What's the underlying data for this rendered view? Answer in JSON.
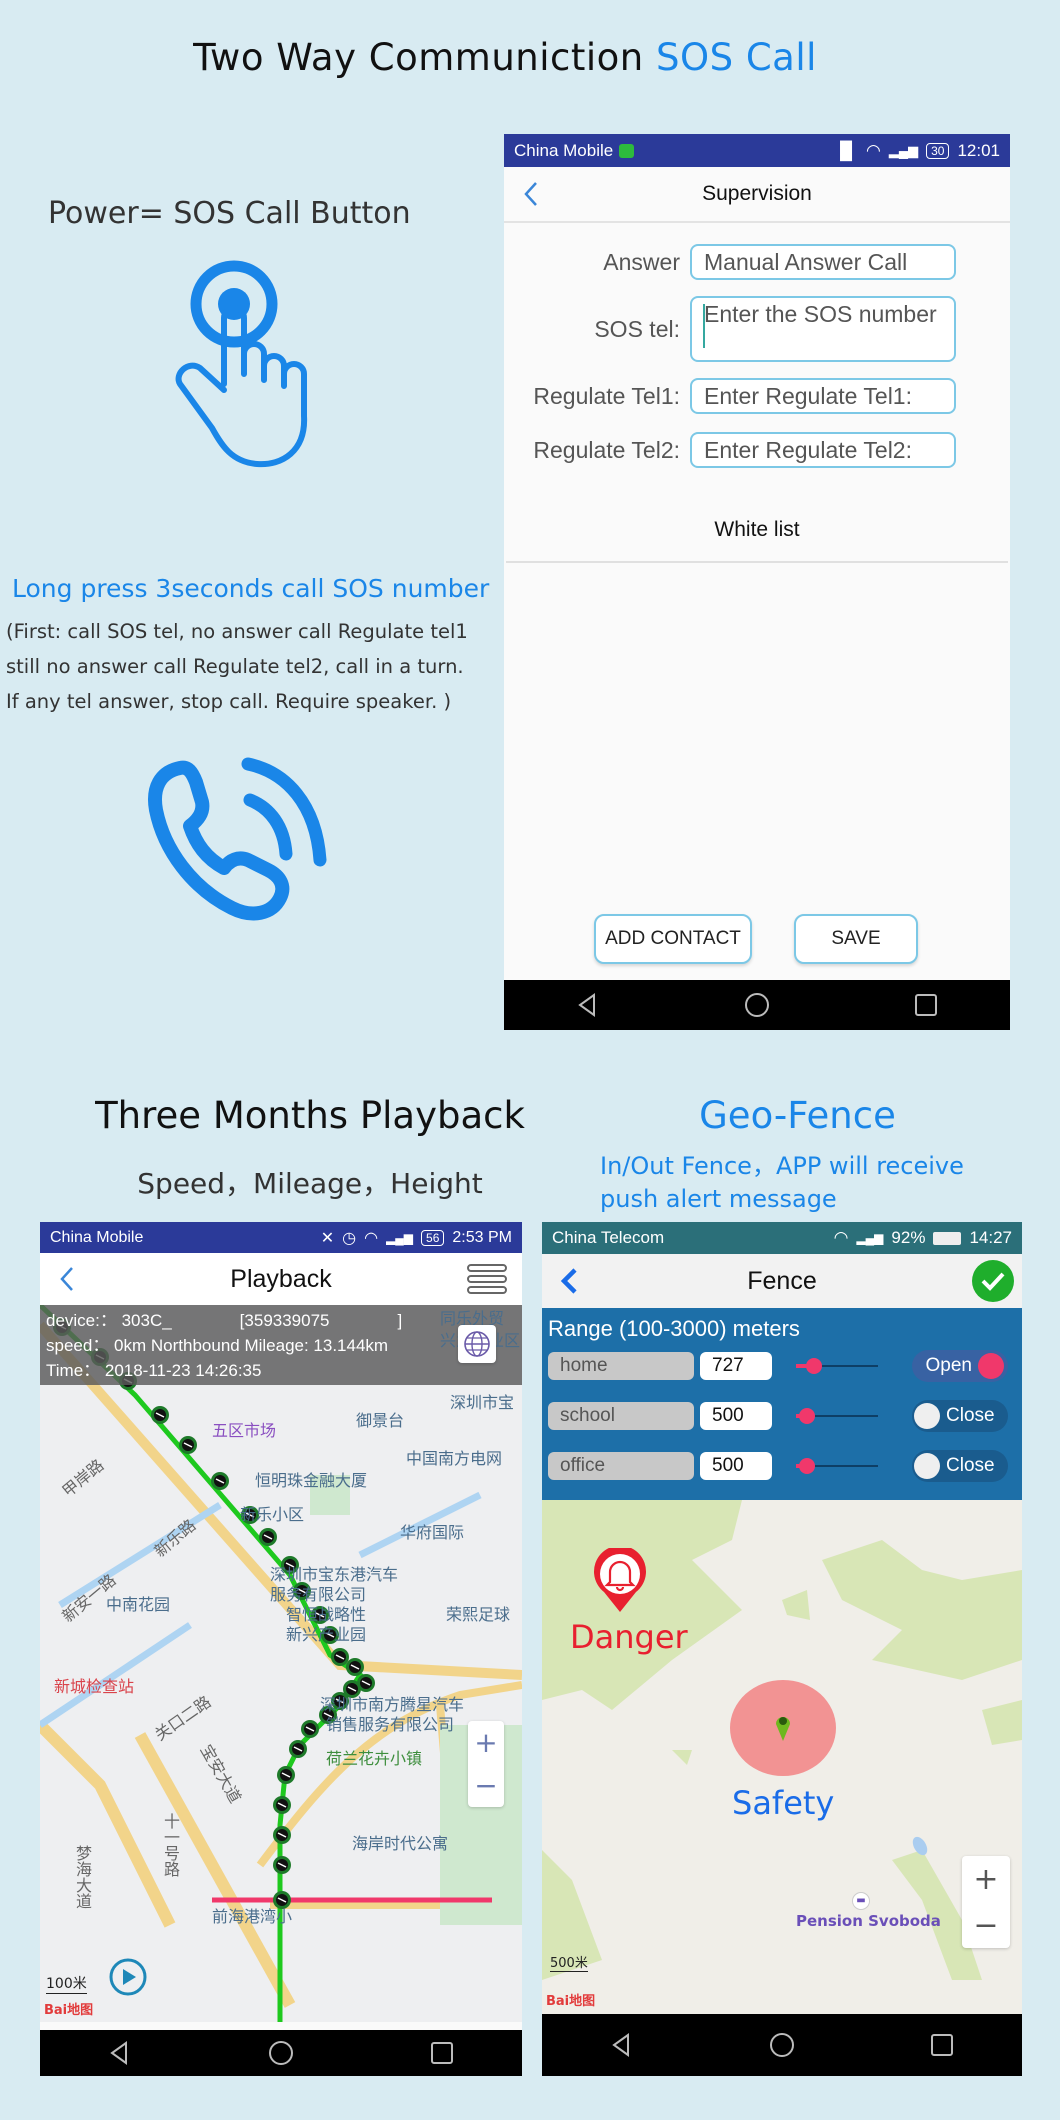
{
  "page": {
    "main_title": "Two Way Communiction ",
    "main_title_accent": "SOS Call",
    "power_label": "Power= SOS Call Button",
    "long_press": "Long press 3seconds call SOS number",
    "note_lines": [
      "(First: call SOS tel, no answer call Regulate tel1",
      "still no answer call Regulate tel2, call in a turn.",
      "If any tel answer, stop call. Require speaker. )"
    ],
    "playback_title": "Three Months Playback",
    "playback_subtitle": "Speed，Mileage，Height",
    "geofence_title": "Geo-Fence",
    "geofence_subtitle_lines": [
      "In/Out Fence，APP will receive",
      "push alert message"
    ],
    "accent_color": "#1a86e8"
  },
  "icons": {
    "tap": "hand-tap-icon",
    "call": "phone-ringing-icon"
  },
  "supervision_phone": {
    "status": {
      "carrier": "China Mobile",
      "battery": "30",
      "time": "12:01",
      "network": "4G"
    },
    "title": "Supervision",
    "fields": [
      {
        "label": "Answer",
        "value": "Manual Answer Call",
        "placeholder": ""
      },
      {
        "label": "SOS tel:",
        "value": "",
        "placeholder": "Enter the SOS number"
      },
      {
        "label": "Regulate Tel1:",
        "value": "",
        "placeholder": "Enter Regulate Tel1:"
      },
      {
        "label": "Regulate Tel2:",
        "value": "",
        "placeholder": "Enter Regulate Tel2:"
      }
    ],
    "whitelist_label": "White list",
    "add_contact_label": "ADD CONTACT",
    "save_label": "SAVE"
  },
  "playback_phone": {
    "status": {
      "carrier": "China Mobile",
      "battery": "56",
      "time": "2:53 PM",
      "network": "4G"
    },
    "title": "Playback",
    "info": {
      "device": "device:： 303C_    [359339075    ]",
      "speed": "speed： 0km  Northbound  Mileage: 13.144km",
      "time": "Time： 2018-11-23 14:26:35"
    },
    "map_labels": [
      "同乐外贸",
      "兴业工业区",
      "深圳市宝",
      "御景台",
      "五区市场",
      "甲岸路",
      "恒明珠金融大厦",
      "中国南方电网",
      "新乐小区",
      "新乐路",
      "华府国际",
      "新安一路",
      "深圳市宝东港汽车",
      "服务有限公司",
      "中南花园",
      "智恒战略性",
      "新兴产业园",
      "荣熙足球",
      "新城检查站",
      "关口二路",
      "深圳市南方腾星汽车",
      "销售服务有限公司",
      "荷兰花卉小镇",
      "宝安大道",
      "十一号路",
      "海岸时代公寓",
      "前海港湾小",
      "梦海大道"
    ],
    "scale": "100米",
    "map_logo": "Bai地图"
  },
  "fence_phone": {
    "status": {
      "carrier": "China Telecom",
      "battery": "92%",
      "time": "14:27",
      "network": "4G 2G"
    },
    "title": "Fence",
    "range_label": "Range (100-3000) meters",
    "range_min": 100,
    "range_max": 3000,
    "fences": [
      {
        "name": "home",
        "value": "727",
        "slider_fraction": 0.22,
        "state": "Open",
        "enabled": true
      },
      {
        "name": "school",
        "value": "500",
        "slider_fraction": 0.14,
        "state": "Close",
        "enabled": false
      },
      {
        "name": "office",
        "value": "500",
        "slider_fraction": 0.14,
        "state": "Close",
        "enabled": false
      }
    ],
    "danger_label": "Danger",
    "safety_label": "Safety",
    "poi_label": "Pension Svoboda",
    "scale": "500米",
    "map_logo": "Bai地图",
    "colors": {
      "danger": "#e8202f",
      "safety": "#1a6ce8",
      "fence_circle": "#f08c8c"
    }
  },
  "nav": {
    "back": "back-icon",
    "home": "home-icon",
    "recents": "recents-icon"
  }
}
